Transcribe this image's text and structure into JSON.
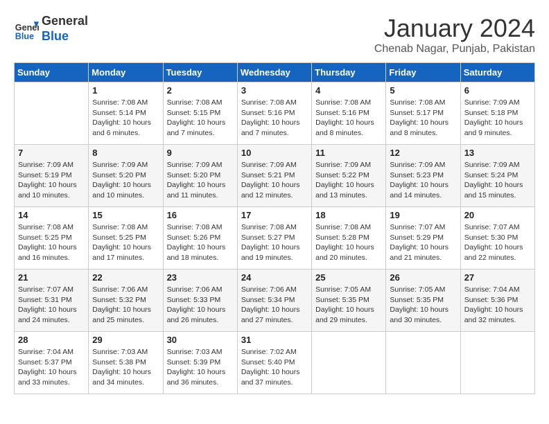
{
  "header": {
    "logo_line1": "General",
    "logo_line2": "Blue",
    "month_title": "January 2024",
    "location": "Chenab Nagar, Punjab, Pakistan"
  },
  "days_of_week": [
    "Sunday",
    "Monday",
    "Tuesday",
    "Wednesday",
    "Thursday",
    "Friday",
    "Saturday"
  ],
  "weeks": [
    [
      {
        "day": "",
        "info": ""
      },
      {
        "day": "1",
        "info": "Sunrise: 7:08 AM\nSunset: 5:14 PM\nDaylight: 10 hours\nand 6 minutes."
      },
      {
        "day": "2",
        "info": "Sunrise: 7:08 AM\nSunset: 5:15 PM\nDaylight: 10 hours\nand 7 minutes."
      },
      {
        "day": "3",
        "info": "Sunrise: 7:08 AM\nSunset: 5:16 PM\nDaylight: 10 hours\nand 7 minutes."
      },
      {
        "day": "4",
        "info": "Sunrise: 7:08 AM\nSunset: 5:16 PM\nDaylight: 10 hours\nand 8 minutes."
      },
      {
        "day": "5",
        "info": "Sunrise: 7:08 AM\nSunset: 5:17 PM\nDaylight: 10 hours\nand 8 minutes."
      },
      {
        "day": "6",
        "info": "Sunrise: 7:09 AM\nSunset: 5:18 PM\nDaylight: 10 hours\nand 9 minutes."
      }
    ],
    [
      {
        "day": "7",
        "info": "Sunrise: 7:09 AM\nSunset: 5:19 PM\nDaylight: 10 hours\nand 10 minutes."
      },
      {
        "day": "8",
        "info": "Sunrise: 7:09 AM\nSunset: 5:20 PM\nDaylight: 10 hours\nand 10 minutes."
      },
      {
        "day": "9",
        "info": "Sunrise: 7:09 AM\nSunset: 5:20 PM\nDaylight: 10 hours\nand 11 minutes."
      },
      {
        "day": "10",
        "info": "Sunrise: 7:09 AM\nSunset: 5:21 PM\nDaylight: 10 hours\nand 12 minutes."
      },
      {
        "day": "11",
        "info": "Sunrise: 7:09 AM\nSunset: 5:22 PM\nDaylight: 10 hours\nand 13 minutes."
      },
      {
        "day": "12",
        "info": "Sunrise: 7:09 AM\nSunset: 5:23 PM\nDaylight: 10 hours\nand 14 minutes."
      },
      {
        "day": "13",
        "info": "Sunrise: 7:09 AM\nSunset: 5:24 PM\nDaylight: 10 hours\nand 15 minutes."
      }
    ],
    [
      {
        "day": "14",
        "info": "Sunrise: 7:08 AM\nSunset: 5:25 PM\nDaylight: 10 hours\nand 16 minutes."
      },
      {
        "day": "15",
        "info": "Sunrise: 7:08 AM\nSunset: 5:25 PM\nDaylight: 10 hours\nand 17 minutes."
      },
      {
        "day": "16",
        "info": "Sunrise: 7:08 AM\nSunset: 5:26 PM\nDaylight: 10 hours\nand 18 minutes."
      },
      {
        "day": "17",
        "info": "Sunrise: 7:08 AM\nSunset: 5:27 PM\nDaylight: 10 hours\nand 19 minutes."
      },
      {
        "day": "18",
        "info": "Sunrise: 7:08 AM\nSunset: 5:28 PM\nDaylight: 10 hours\nand 20 minutes."
      },
      {
        "day": "19",
        "info": "Sunrise: 7:07 AM\nSunset: 5:29 PM\nDaylight: 10 hours\nand 21 minutes."
      },
      {
        "day": "20",
        "info": "Sunrise: 7:07 AM\nSunset: 5:30 PM\nDaylight: 10 hours\nand 22 minutes."
      }
    ],
    [
      {
        "day": "21",
        "info": "Sunrise: 7:07 AM\nSunset: 5:31 PM\nDaylight: 10 hours\nand 24 minutes."
      },
      {
        "day": "22",
        "info": "Sunrise: 7:06 AM\nSunset: 5:32 PM\nDaylight: 10 hours\nand 25 minutes."
      },
      {
        "day": "23",
        "info": "Sunrise: 7:06 AM\nSunset: 5:33 PM\nDaylight: 10 hours\nand 26 minutes."
      },
      {
        "day": "24",
        "info": "Sunrise: 7:06 AM\nSunset: 5:34 PM\nDaylight: 10 hours\nand 27 minutes."
      },
      {
        "day": "25",
        "info": "Sunrise: 7:05 AM\nSunset: 5:35 PM\nDaylight: 10 hours\nand 29 minutes."
      },
      {
        "day": "26",
        "info": "Sunrise: 7:05 AM\nSunset: 5:35 PM\nDaylight: 10 hours\nand 30 minutes."
      },
      {
        "day": "27",
        "info": "Sunrise: 7:04 AM\nSunset: 5:36 PM\nDaylight: 10 hours\nand 32 minutes."
      }
    ],
    [
      {
        "day": "28",
        "info": "Sunrise: 7:04 AM\nSunset: 5:37 PM\nDaylight: 10 hours\nand 33 minutes."
      },
      {
        "day": "29",
        "info": "Sunrise: 7:03 AM\nSunset: 5:38 PM\nDaylight: 10 hours\nand 34 minutes."
      },
      {
        "day": "30",
        "info": "Sunrise: 7:03 AM\nSunset: 5:39 PM\nDaylight: 10 hours\nand 36 minutes."
      },
      {
        "day": "31",
        "info": "Sunrise: 7:02 AM\nSunset: 5:40 PM\nDaylight: 10 hours\nand 37 minutes."
      },
      {
        "day": "",
        "info": ""
      },
      {
        "day": "",
        "info": ""
      },
      {
        "day": "",
        "info": ""
      }
    ]
  ]
}
